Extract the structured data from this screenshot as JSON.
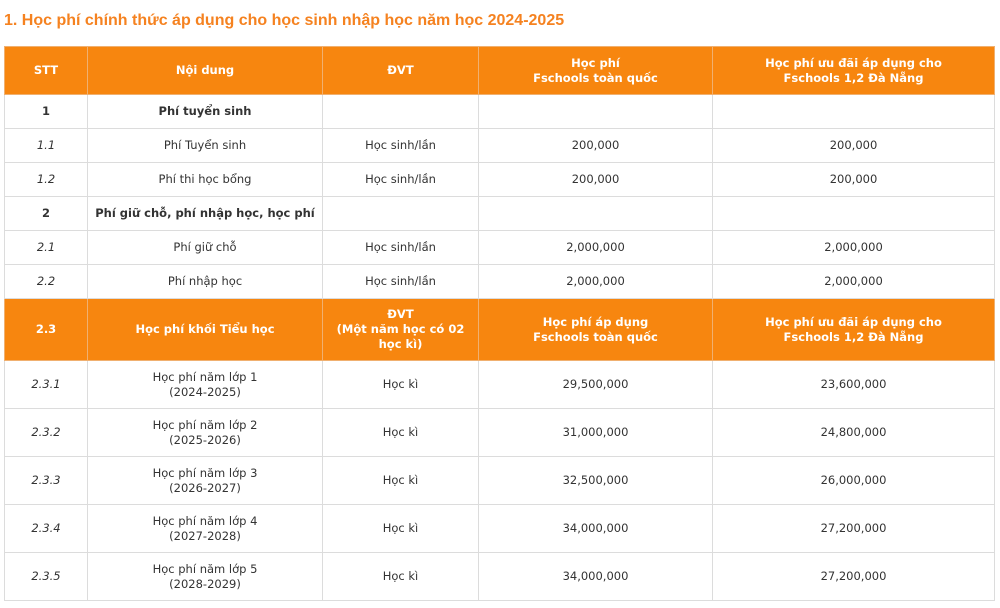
{
  "title": "1. Học phí chính thức áp dụng cho học sinh nhập học năm học 2024-2025",
  "header": {
    "stt": "STT",
    "content": "Nội dung",
    "unit": "ĐVT",
    "national_line1": "Học phí",
    "national_line2": "Fschools toàn quốc",
    "danang_line1": "Học phí ưu đãi áp dụng cho",
    "danang_line2": "Fschools 1,2 Đà Nẵng"
  },
  "section1": {
    "stt": "1",
    "label": "Phí tuyển sinh"
  },
  "rows1": [
    {
      "stt": "1.1",
      "content": "Phí Tuyển sinh",
      "unit": "Học sinh/lần",
      "national": "200,000",
      "danang": "200,000"
    },
    {
      "stt": "1.2",
      "content": "Phí thi học bổng",
      "unit": "Học sinh/lần",
      "national": "200,000",
      "danang": "200,000"
    }
  ],
  "section2": {
    "stt": "2",
    "label": "Phí giữ chỗ, phí nhập học, học phí"
  },
  "rows2": [
    {
      "stt": "2.1",
      "content": "Phí giữ chỗ",
      "unit": "Học sinh/lần",
      "national": "2,000,000",
      "danang": "2,000,000"
    },
    {
      "stt": "2.2",
      "content": "Phí nhập học",
      "unit": "Học sinh/lần",
      "national": "2,000,000",
      "danang": "2,000,000"
    }
  ],
  "subheader": {
    "stt": "2.3",
    "content": "Học phí khối Tiểu học",
    "unit_line1": "ĐVT",
    "unit_line2": "(Một năm học có 02",
    "unit_line3": "học kì)",
    "national_line1": "Học phí áp dụng",
    "national_line2": "Fschools toàn quốc",
    "danang_line1": "Học phí ưu đãi áp dụng cho",
    "danang_line2": "Fschools 1,2 Đà Nẵng"
  },
  "rows3": [
    {
      "stt": "2.3.1",
      "content_line1": "Học phí năm lớp 1",
      "content_line2": "(2024-2025)",
      "unit": "Học kì",
      "national": "29,500,000",
      "danang": "23,600,000"
    },
    {
      "stt": "2.3.2",
      "content_line1": "Học phí năm lớp 2",
      "content_line2": "(2025-2026)",
      "unit": "Học kì",
      "national": "31,000,000",
      "danang": "24,800,000"
    },
    {
      "stt": "2.3.3",
      "content_line1": "Học phí năm lớp 3",
      "content_line2": "(2026-2027)",
      "unit": "Học kì",
      "national": "32,500,000",
      "danang": "26,000,000"
    },
    {
      "stt": "2.3.4",
      "content_line1": "Học phí năm lớp 4",
      "content_line2": "(2027-2028)",
      "unit": "Học kì",
      "national": "34,000,000",
      "danang": "27,200,000"
    },
    {
      "stt": "2.3.5",
      "content_line1": "Học phí năm lớp 5",
      "content_line2": "(2028-2029)",
      "unit": "Học kì",
      "national": "34,000,000",
      "danang": "27,200,000"
    }
  ]
}
